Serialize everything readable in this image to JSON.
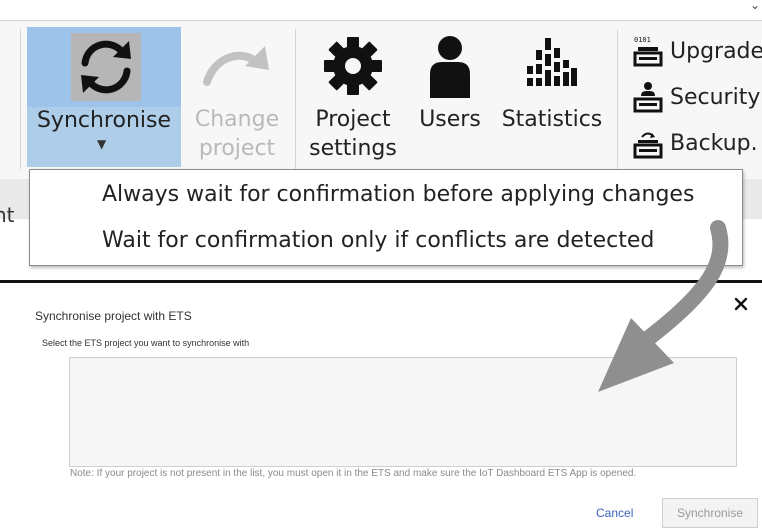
{
  "ribbon": {
    "synchronise": {
      "label": "Synchronise",
      "icon": "sync-icon"
    },
    "change_project": {
      "label": "Change\nproject",
      "icon": "redo-arrow-icon"
    },
    "project_settings": {
      "label": "Project\nsettings",
      "icon": "gear-icon"
    },
    "users": {
      "label": "Users",
      "icon": "user-icon"
    },
    "statistics": {
      "label": "Statistics",
      "icon": "statistics-icon"
    },
    "upgrade": {
      "label": "Upgrade",
      "icon": "upgrade-icon",
      "badge": "0101"
    },
    "security": {
      "label": "Security",
      "icon": "security-icon"
    },
    "backup": {
      "label": "Backup.",
      "icon": "backup-icon"
    }
  },
  "band": {
    "partial_text": "nt"
  },
  "menu": {
    "items": [
      "Always wait for confirmation before applying changes",
      "Wait for confirmation only if conflicts are detected"
    ]
  },
  "dialog": {
    "title": "Synchronise project with ETS",
    "subtitle": "Select the ETS project you want to synchronise with",
    "note": "Note: If your project is not present in the list, you must open it in the ETS and make sure the IoT Dashboard ETS App  is opened.",
    "cancel_label": "Cancel",
    "synchronise_label": "Synchronise"
  },
  "colors": {
    "selection": "#9ec3ea",
    "disabled": "#c2c2c2",
    "arrow": "#8f8f8f",
    "link": "#3a63b8"
  }
}
